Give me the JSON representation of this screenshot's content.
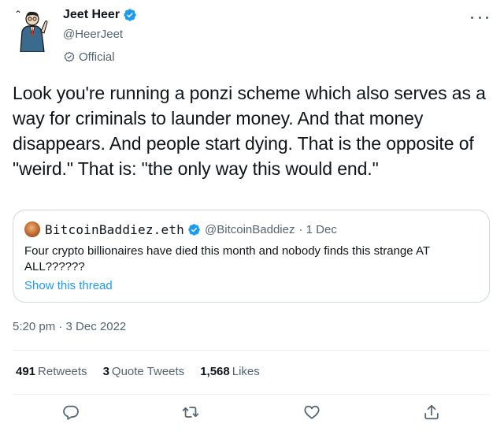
{
  "author": {
    "name": "Jeet Heer",
    "handle": "@HeerJeet",
    "label": "Official"
  },
  "tweet": {
    "text": "Look you're running a ponzi scheme which also serves as a way for criminals to launder money. And that money disappears. And people start dying. That is the opposite of \"weird.\" That is: \"the only way this would end.\"",
    "timestamp": "5:20 pm · 3 Dec 2022"
  },
  "quote": {
    "name": "BitcoinBaddiez.eth",
    "handle": "@BitcoinBaddiez",
    "date": "· 1 Dec",
    "text": "Four crypto billionaires have died this month and nobody finds this strange AT ALL??????",
    "link": "Show this thread"
  },
  "stats": {
    "retweets_count": "491",
    "retweets_label": "Retweets",
    "quotes_count": "3",
    "quotes_label": "Quote Tweets",
    "likes_count": "1,568",
    "likes_label": "Likes"
  },
  "icons": {
    "verified": "verified-badge-icon",
    "official": "official-check-icon",
    "more": "more-options-icon",
    "reply": "reply-icon",
    "retweet": "retweet-icon",
    "like": "heart-icon",
    "share": "share-icon"
  },
  "colors": {
    "accent": "#1d9bf0",
    "text": "#0f1419",
    "muted": "#536471",
    "border": "#cfd9de"
  }
}
